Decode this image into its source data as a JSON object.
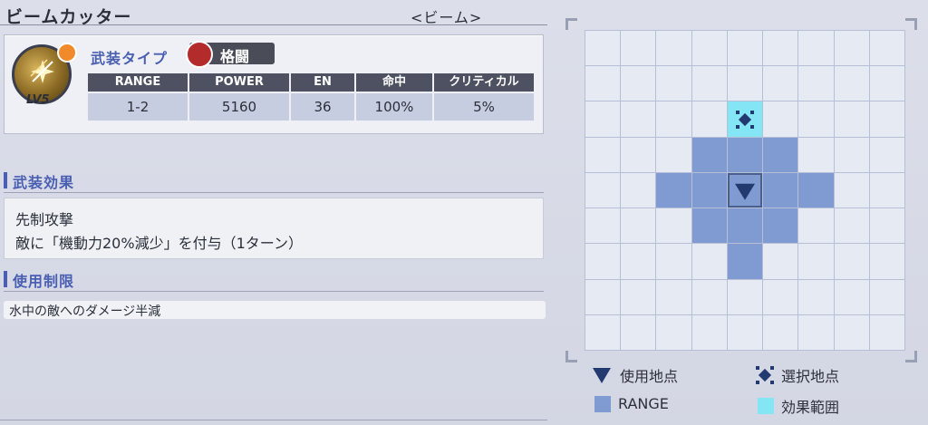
{
  "weapon": {
    "name": "ビームカッター",
    "category": "<ビーム>",
    "level": "LV5"
  },
  "type_row": {
    "label": "武装タイプ",
    "type_value": "格闘"
  },
  "stats": {
    "headers": [
      "RANGE",
      "POWER",
      "EN",
      "命中",
      "クリティカル"
    ],
    "values": [
      "1-2",
      "5160",
      "36",
      "100%",
      "5%"
    ]
  },
  "effects": {
    "title": "武装効果",
    "line1": "先制攻撃",
    "line2": "敵に「機動力20%減少」を付与（1ターン）"
  },
  "restriction": {
    "title": "使用制限",
    "text": "水中の敵へのダメージ半減"
  },
  "legend": {
    "use_point": "使用地点",
    "select_point": "選択地点",
    "range": "RANGE",
    "effect_area": "効果範囲"
  },
  "grid": {
    "cols": 9,
    "rows": 9,
    "range_cells": [
      [
        3,
        3
      ],
      [
        4,
        3
      ],
      [
        5,
        3
      ],
      [
        2,
        4
      ],
      [
        3,
        4
      ],
      [
        5,
        4
      ],
      [
        6,
        4
      ],
      [
        3,
        5
      ],
      [
        4,
        5
      ],
      [
        5,
        5
      ],
      [
        4,
        6
      ]
    ],
    "effect_cells": [
      [
        4,
        2
      ]
    ],
    "use_point": [
      4,
      4
    ],
    "select_point": [
      4,
      2
    ]
  },
  "colors": {
    "accent": "#4a5fb2",
    "range": "#7f9bd2",
    "effect": "#84e6f5",
    "marker": "#233a70",
    "type_badge": "#b32b2b"
  }
}
